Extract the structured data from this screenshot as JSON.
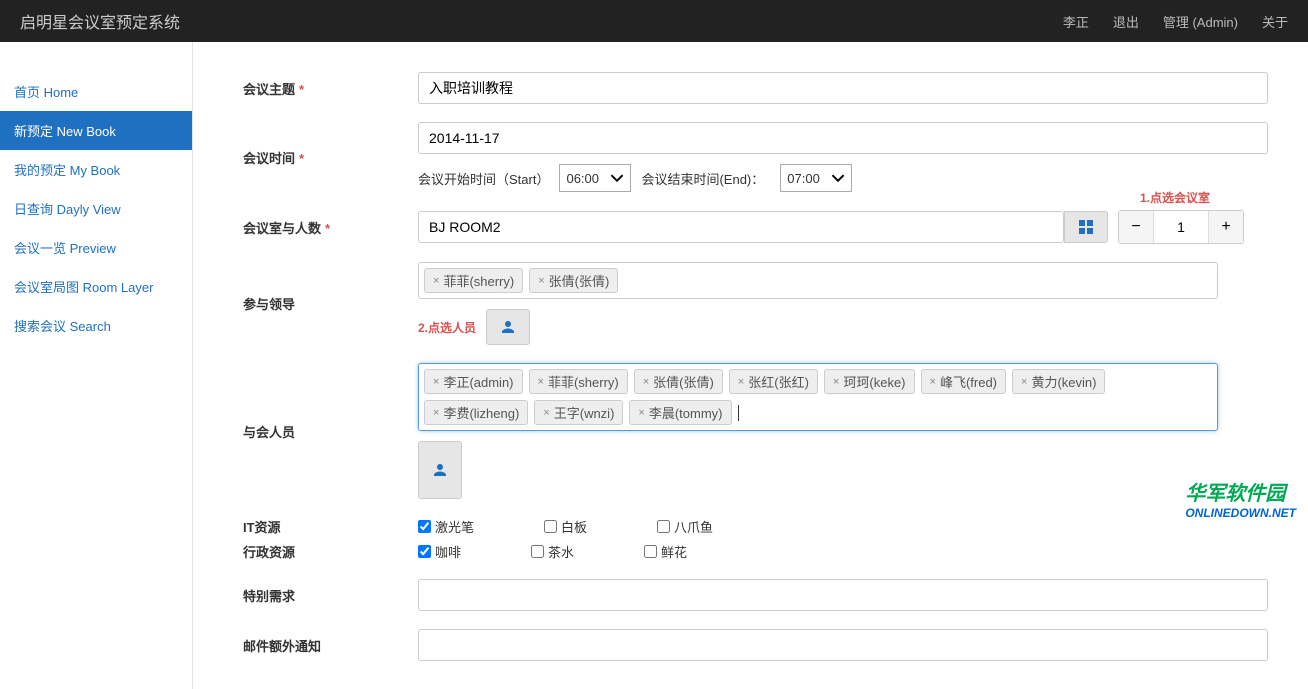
{
  "header": {
    "brand": "启明星会议室预定系统",
    "user": "李正",
    "logout": "退出",
    "admin": "管理 (Admin)",
    "about": "关于"
  },
  "sidebar": {
    "items": [
      {
        "label": "首页 Home"
      },
      {
        "label": "新预定 New Book",
        "active": true
      },
      {
        "label": "我的预定 My Book"
      },
      {
        "label": "日查询 Dayly View"
      },
      {
        "label": "会议一览 Preview"
      },
      {
        "label": "会议室局图 Room Layer"
      },
      {
        "label": "搜索会议 Search"
      }
    ]
  },
  "form": {
    "subject_label": "会议主题",
    "subject_value": "入职培训教程",
    "time_label": "会议时间",
    "date_value": "2014-11-17",
    "start_label": "会议开始时间（Start）",
    "start_value": "06:00",
    "end_label": "会议结束时间(End)：",
    "end_value": "07:00",
    "hint1": "1.点选会议室",
    "room_label": "会议室与人数",
    "room_value": "BJ ROOM2",
    "count_value": "1",
    "leaders_label": "参与领导",
    "leaders": [
      "菲菲(sherry)",
      "张倩(张倩)"
    ],
    "hint2": "2.点选人员",
    "members_label": "与会人员",
    "members": [
      "李正(admin)",
      "菲菲(sherry)",
      "张倩(张倩)",
      "张红(张红)",
      "珂珂(keke)",
      "峰飞(fred)",
      "黄力(kevin)",
      "李费(lizheng)",
      "王字(wnzi)",
      "李晨(tommy)"
    ],
    "it_label": "IT资源",
    "it_opts": [
      {
        "label": "激光笔",
        "checked": true
      },
      {
        "label": "白板",
        "checked": false
      },
      {
        "label": "八爪鱼",
        "checked": false
      }
    ],
    "admin_label": "行政资源",
    "admin_opts": [
      {
        "label": "咖啡",
        "checked": true
      },
      {
        "label": "茶水",
        "checked": false
      },
      {
        "label": "鲜花",
        "checked": false
      }
    ],
    "special_label": "特别需求",
    "notify_label": "邮件额外通知"
  },
  "watermark": {
    "zh": "华军软件园",
    "en": "ONLINEDOWN.NET"
  }
}
